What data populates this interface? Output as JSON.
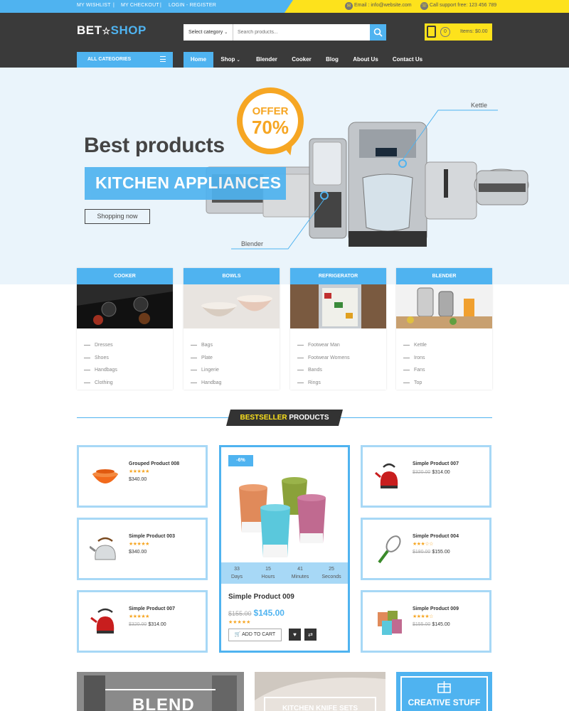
{
  "topbar": {
    "links": [
      "MY WISHLIST",
      "MY CHECKOUT",
      "LOGIN - REGISTER"
    ],
    "email": "Email : info@website.com",
    "support": "Call support free: 123 456 789",
    "email_icon": "mail-icon",
    "phone_icon": "phone-icon"
  },
  "header": {
    "logo_a": "BET",
    "logo_b": "SHOP",
    "category_select": "Select category",
    "search_placeholder": "Search products...",
    "cart_count": "0",
    "cart_text": "Items: $0.00"
  },
  "nav": {
    "all_categories": "ALL CATEGORIES",
    "items": [
      "Home",
      "Shop",
      "Blender",
      "Cooker",
      "Blog",
      "About Us",
      "Contact Us"
    ],
    "active": "Home"
  },
  "hero": {
    "title": "Best products",
    "subtitle": "KITCHEN APPLIANCES",
    "button": "Shopping now",
    "offer_line1": "OFFER",
    "offer_line2": "70%",
    "callout_kettle": "Kettle",
    "callout_blender": "Blender"
  },
  "categories": [
    {
      "title": "COOKER",
      "items": [
        "Dresses",
        "Shoes",
        "Handbags",
        "Clothing"
      ]
    },
    {
      "title": "BOWLS",
      "items": [
        "Bags",
        "Plate",
        "Lingerie",
        "Handbag"
      ]
    },
    {
      "title": "REFRIGERATOR",
      "items": [
        "Footwear Man",
        "Footwear Womens",
        "Bands",
        "Rings"
      ]
    },
    {
      "title": "BLENDER",
      "items": [
        "Kettle",
        "Irons",
        "Fans",
        "Top"
      ]
    }
  ],
  "bestseller": {
    "title_a": "BESTSELLER",
    "title_b": " PRODUCTS",
    "products": [
      {
        "name": "Grouped Product 008",
        "stars": "★★★★★",
        "old": "",
        "price": "$340.00"
      },
      {
        "name": "Simple Product 003",
        "stars": "★★★★★",
        "old": "",
        "price": "$340.00"
      },
      {
        "name": "Simple Product 007",
        "stars": "★★★★★",
        "old": "$320.00",
        "price": "$314.00"
      },
      {
        "name": "Simple Product 007",
        "stars": "",
        "old": "$320.00",
        "price": "$314.00"
      },
      {
        "name": "Simple Product 004",
        "stars": "★★★☆☆",
        "old": "$180.00",
        "price": "$155.00"
      },
      {
        "name": "Simple Product 009",
        "stars": "★★★★☆",
        "old": "$155.00",
        "price": "$145.00"
      }
    ],
    "featured": {
      "badge": "-6%",
      "timer": [
        {
          "value": "33",
          "unit": "Days"
        },
        {
          "value": "15",
          "unit": "Hours"
        },
        {
          "value": "41",
          "unit": "Minutes"
        },
        {
          "value": "25",
          "unit": "Seconds"
        }
      ],
      "name": "Simple Product 009",
      "old": "$155.00",
      "price": "$145.00",
      "stars": "★★★★★",
      "add_to_cart": "ADD TO CART"
    }
  },
  "banners": {
    "b1": "BLEND",
    "b2": "KITCHEN KNIFE SETS",
    "b3": "CREATIVE STUFF"
  }
}
